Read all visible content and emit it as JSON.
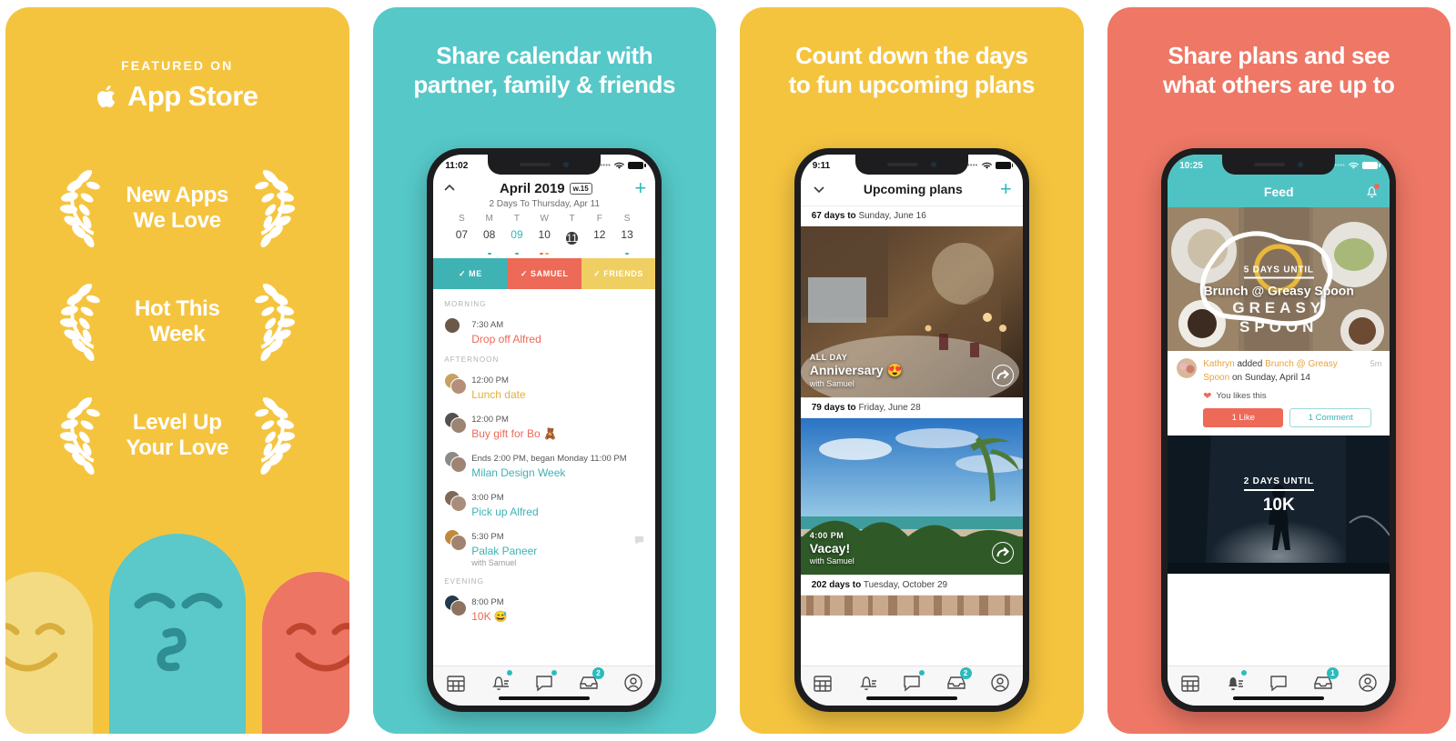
{
  "colors": {
    "yellow": "#F5C43F",
    "teal": "#56C8C8",
    "coral": "#EE7765",
    "accent_teal": "#2CBBBC",
    "accent_coral": "#EC6A57",
    "accent_yellow": "#E2B03C"
  },
  "panels": {
    "p1": {
      "featured_label": "FEATURED ON",
      "store_label": "App Store",
      "apple_icon": "apple-logo-icon",
      "awards": [
        {
          "line1": "New Apps",
          "line2": "We Love"
        },
        {
          "line1": "Hot This",
          "line2": "Week"
        },
        {
          "line1": "Level Up",
          "line2": "Your Love"
        }
      ]
    },
    "p2": {
      "headline_line1": "Share calendar with",
      "headline_line2": "partner, family & friends",
      "status": {
        "time": "11:02",
        "dots": "••••"
      },
      "calendar": {
        "month": "April 2019",
        "week_badge": "w.15",
        "subtitle": "2 Days To Thursday, Apr 11",
        "add_label": "+",
        "dow": [
          "S",
          "M",
          "T",
          "W",
          "T",
          "F",
          "S"
        ],
        "days": [
          {
            "num": "07",
            "state": "normal",
            "dots": []
          },
          {
            "num": "08",
            "state": "normal",
            "dots": [
              "#3FB2B4"
            ]
          },
          {
            "num": "09",
            "state": "active",
            "dots": [
              "#3FB2B4"
            ]
          },
          {
            "num": "10",
            "state": "normal",
            "dots": [
              "#EC6A57",
              "#E2B03C"
            ]
          },
          {
            "num": "11",
            "state": "today",
            "dots": []
          },
          {
            "num": "12",
            "state": "normal",
            "dots": []
          },
          {
            "num": "13",
            "state": "normal",
            "dots": [
              "#3FB2B4"
            ]
          }
        ],
        "filters": [
          {
            "label": "ME",
            "check": "✓"
          },
          {
            "label": "SAMUEL",
            "check": "✓"
          },
          {
            "label": "FRIENDS",
            "check": "✓"
          }
        ],
        "sections": [
          {
            "label": "MORNING",
            "events": [
              {
                "time": "7:30 AM",
                "title": "Drop off Alfred",
                "color": "c-coral",
                "sub": "",
                "avatars": 1,
                "chat": false
              }
            ]
          },
          {
            "label": "AFTERNOON",
            "events": [
              {
                "time": "12:00 PM",
                "title": "Lunch date",
                "color": "c-yellow",
                "sub": "",
                "avatars": 2,
                "chat": false
              },
              {
                "time": "12:00 PM",
                "title": "Buy gift for Bo 🧸",
                "color": "c-coral",
                "sub": "",
                "avatars": 2,
                "chat": false
              },
              {
                "time": "Ends 2:00 PM, began Monday 11:00 PM",
                "title": "Milan Design Week",
                "color": "c-teal",
                "sub": "",
                "avatars": 2,
                "chat": false
              },
              {
                "time": "3:00 PM",
                "title": "Pick up Alfred",
                "color": "c-teal",
                "sub": "",
                "avatars": 2,
                "chat": false
              },
              {
                "time": "5:30 PM",
                "title": "Palak Paneer",
                "color": "c-teal",
                "sub": "with Samuel",
                "avatars": 2,
                "chat": true
              }
            ]
          },
          {
            "label": "EVENING",
            "events": [
              {
                "time": "8:00 PM",
                "title": "10K 😅",
                "color": "c-coral",
                "sub": "",
                "avatars": 2,
                "chat": false
              }
            ]
          }
        ]
      },
      "tabbar": [
        {
          "icon": "calendar-icon",
          "badge": "",
          "dot": false
        },
        {
          "icon": "bell-list-icon",
          "badge": "",
          "dot": true
        },
        {
          "icon": "chat-bubble-icon",
          "badge": "",
          "dot": true
        },
        {
          "icon": "inbox-icon",
          "badge": "2",
          "dot": false
        },
        {
          "icon": "profile-icon",
          "badge": "",
          "dot": false
        }
      ]
    },
    "p3": {
      "headline_line1": "Count down the days",
      "headline_line2": "to fun upcoming plans",
      "status": {
        "time": "9:11",
        "dots": "••••"
      },
      "nav_title": "Upcoming plans",
      "add_label": "+",
      "plans": [
        {
          "countdown_days": "67 days to",
          "countdown_date": "Sunday, June 16",
          "kicker": "ALL DAY",
          "name": "Anniversary 😍",
          "with": "with Samuel",
          "theme": "dinner"
        },
        {
          "countdown_days": "79 days to",
          "countdown_date": "Friday, June 28",
          "kicker": "4:00 PM",
          "name": "Vacay!",
          "with": "with Samuel",
          "theme": "beach"
        },
        {
          "countdown_days": "202 days to",
          "countdown_date": "Tuesday, October 29",
          "kicker": "",
          "name": "",
          "with": "",
          "theme": "strip"
        }
      ],
      "tabbar": [
        {
          "icon": "calendar-icon",
          "badge": "",
          "dot": false
        },
        {
          "icon": "bell-list-icon",
          "badge": "",
          "dot": false
        },
        {
          "icon": "chat-bubble-icon",
          "badge": "",
          "dot": true
        },
        {
          "icon": "inbox-icon",
          "badge": "2",
          "dot": false
        },
        {
          "icon": "profile-icon",
          "badge": "",
          "dot": false
        }
      ]
    },
    "p4": {
      "headline_line1": "Share plans and see",
      "headline_line2": "what others are up to",
      "status": {
        "time": "10:25",
        "dots": "••••"
      },
      "nav_title": "Feed",
      "bell_icon": "bell-notification-icon",
      "posts": [
        {
          "days_until": "5 DAYS UNTIL",
          "plan_name": "Brunch @ Greasy Spoon",
          "brand_line1": "GREASY",
          "brand_line2": "SPOON",
          "author": "Kathryn",
          "action": " added ",
          "target": "Brunch @ Greasy Spoon",
          "tail": " on Sunday, April 14",
          "age": "5m",
          "likes_text": "You likes this",
          "like_button": "1 Like",
          "comment_button": "1 Comment"
        },
        {
          "days_until": "2 DAYS UNTIL",
          "plan_name": "10K"
        }
      ],
      "tabbar": [
        {
          "icon": "calendar-icon",
          "badge": "",
          "dot": false
        },
        {
          "icon": "bell-list-icon",
          "badge": "",
          "dot": true
        },
        {
          "icon": "chat-bubble-icon",
          "badge": "",
          "dot": false
        },
        {
          "icon": "inbox-icon",
          "badge": "1",
          "dot": false
        },
        {
          "icon": "profile-icon",
          "badge": "",
          "dot": false
        }
      ]
    }
  }
}
